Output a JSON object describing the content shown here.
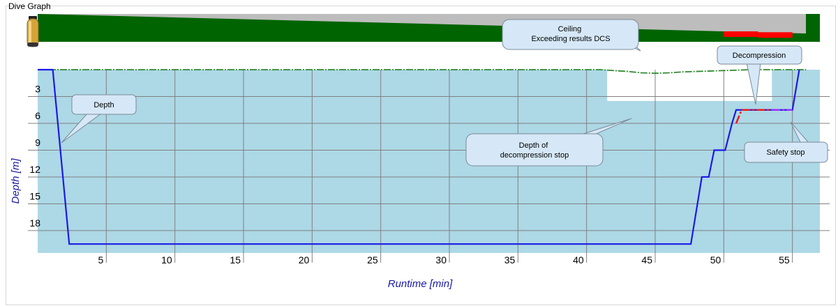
{
  "window": {
    "title": "Dive Graph"
  },
  "colors": {
    "plot_bg": "#add8e6",
    "grid": "#808080",
    "depth_line": "#1a1ae6",
    "ceiling_line": "#2e8b2e",
    "decompression_line": "#e81c1c",
    "safety_stop_line": "#9b30ff",
    "gas_fill": "#006400",
    "gas_bg": "#bdbdbd",
    "gas_warning": "#ff0000",
    "callout_fill": "#d6e8f7",
    "callout_stroke": "#7a8a99"
  },
  "icons": {
    "tank": "scuba-tank-icon"
  },
  "chart_data": {
    "type": "line",
    "xlabel": "Runtime [min]",
    "ylabel": "Depth [m]",
    "xlim": [
      0,
      57
    ],
    "ylim": [
      0,
      20.5
    ],
    "y_inverted": true,
    "grid": true,
    "x_ticks": [
      5,
      10,
      15,
      20,
      25,
      30,
      35,
      40,
      45,
      50,
      55
    ],
    "y_ticks": [
      3,
      6,
      9,
      12,
      15,
      18
    ],
    "series": [
      {
        "role": "depth",
        "x": [
          0,
          1.1,
          2.3,
          47.6,
          48.4,
          48.9,
          49.3,
          49.9,
          50.1,
          50.6,
          50.9,
          51.6,
          55.0,
          55.5
        ],
        "y": [
          0,
          0,
          19.5,
          19.5,
          12.0,
          12.0,
          9.0,
          9.0,
          9.0,
          6.0,
          4.5,
          4.5,
          4.5,
          0
        ]
      },
      {
        "role": "ceiling",
        "x": [
          0,
          41,
          42,
          43,
          44,
          45,
          46,
          47,
          48,
          49,
          50,
          51,
          52,
          53,
          54,
          55,
          56
        ],
        "y": [
          0,
          0,
          0.1,
          0.2,
          0.35,
          0.4,
          0.35,
          0.25,
          0.2,
          0.15,
          0.1,
          0.05,
          0,
          0,
          0,
          0,
          0
        ]
      },
      {
        "role": "decompression",
        "x": [
          50.9,
          51.3,
          51.6,
          53.5
        ],
        "y": [
          6.0,
          4.5,
          4.5,
          4.5
        ]
      },
      {
        "role": "safety-stop",
        "x": [
          53.5,
          55.0
        ],
        "y": [
          4.5,
          4.5
        ]
      }
    ],
    "gas_bar": {
      "start_fraction": 1.0,
      "end_fraction": 0.3,
      "warning_from_minute": 50,
      "warning_to_minute": 55
    },
    "annotations": [
      {
        "text": "Depth"
      },
      {
        "text": "Ceiling\nExceeding results DCS"
      },
      {
        "text": "Decompression"
      },
      {
        "text": "Depth of\ndecompression stop"
      },
      {
        "text": "Safety stop"
      }
    ]
  }
}
